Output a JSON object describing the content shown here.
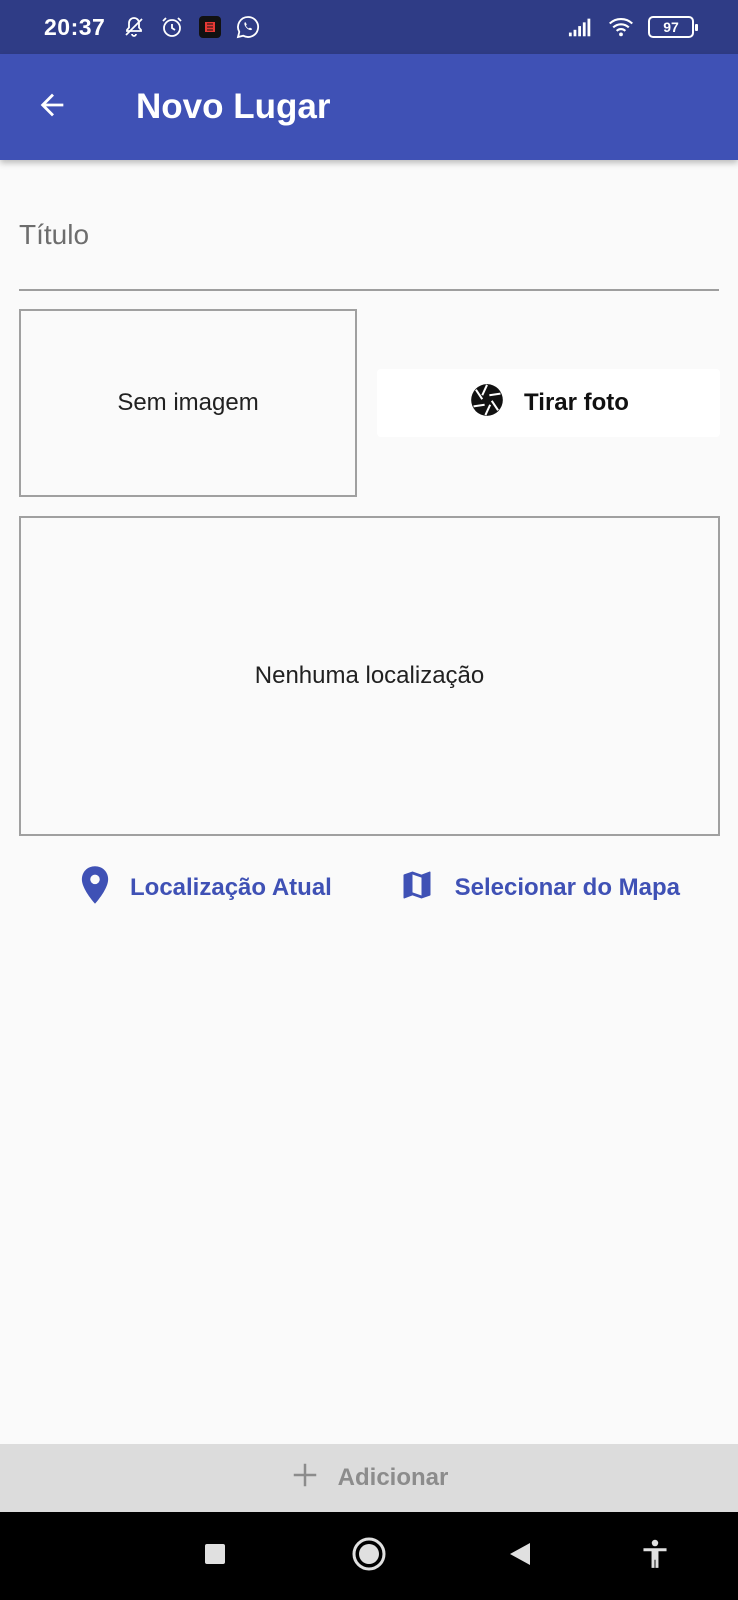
{
  "status_bar": {
    "time": "20:37",
    "battery_level": "97",
    "icons": [
      "muted-notifications-icon",
      "alarm-icon",
      "app-notification-icon",
      "whatsapp-icon",
      "signal-icon",
      "wifi-icon",
      "battery-icon"
    ]
  },
  "app_bar": {
    "title": "Novo Lugar",
    "back_icon": "arrow-left-icon",
    "background": "#3f51b5"
  },
  "form": {
    "title_placeholder": "Título",
    "title_value": ""
  },
  "image_preview": {
    "empty_text": "Sem imagem"
  },
  "photo_button": {
    "label": "Tirar foto",
    "icon": "camera-aperture-icon"
  },
  "location_preview": {
    "empty_text": "Nenhuma localização"
  },
  "location_actions": {
    "current_label": "Localização Atual",
    "current_icon": "location-pin-icon",
    "map_label": "Selecionar do Mapa",
    "map_icon": "map-icon",
    "accent": "#3f51b5"
  },
  "add_button": {
    "label": "Adicionar",
    "icon": "plus-icon"
  },
  "nav_bar": {
    "icons": [
      "recents-square-icon",
      "home-circle-icon",
      "back-triangle-icon",
      "accessibility-icon"
    ]
  }
}
